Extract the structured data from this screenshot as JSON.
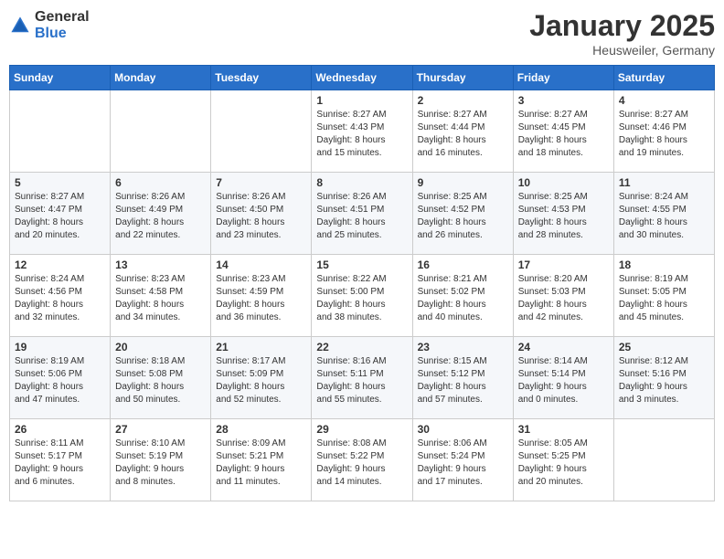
{
  "header": {
    "logo_general": "General",
    "logo_blue": "Blue",
    "month": "January 2025",
    "location": "Heusweiler, Germany"
  },
  "weekdays": [
    "Sunday",
    "Monday",
    "Tuesday",
    "Wednesday",
    "Thursday",
    "Friday",
    "Saturday"
  ],
  "weeks": [
    [
      {
        "day": "",
        "info": ""
      },
      {
        "day": "",
        "info": ""
      },
      {
        "day": "",
        "info": ""
      },
      {
        "day": "1",
        "info": "Sunrise: 8:27 AM\nSunset: 4:43 PM\nDaylight: 8 hours\nand 15 minutes."
      },
      {
        "day": "2",
        "info": "Sunrise: 8:27 AM\nSunset: 4:44 PM\nDaylight: 8 hours\nand 16 minutes."
      },
      {
        "day": "3",
        "info": "Sunrise: 8:27 AM\nSunset: 4:45 PM\nDaylight: 8 hours\nand 18 minutes."
      },
      {
        "day": "4",
        "info": "Sunrise: 8:27 AM\nSunset: 4:46 PM\nDaylight: 8 hours\nand 19 minutes."
      }
    ],
    [
      {
        "day": "5",
        "info": "Sunrise: 8:27 AM\nSunset: 4:47 PM\nDaylight: 8 hours\nand 20 minutes."
      },
      {
        "day": "6",
        "info": "Sunrise: 8:26 AM\nSunset: 4:49 PM\nDaylight: 8 hours\nand 22 minutes."
      },
      {
        "day": "7",
        "info": "Sunrise: 8:26 AM\nSunset: 4:50 PM\nDaylight: 8 hours\nand 23 minutes."
      },
      {
        "day": "8",
        "info": "Sunrise: 8:26 AM\nSunset: 4:51 PM\nDaylight: 8 hours\nand 25 minutes."
      },
      {
        "day": "9",
        "info": "Sunrise: 8:25 AM\nSunset: 4:52 PM\nDaylight: 8 hours\nand 26 minutes."
      },
      {
        "day": "10",
        "info": "Sunrise: 8:25 AM\nSunset: 4:53 PM\nDaylight: 8 hours\nand 28 minutes."
      },
      {
        "day": "11",
        "info": "Sunrise: 8:24 AM\nSunset: 4:55 PM\nDaylight: 8 hours\nand 30 minutes."
      }
    ],
    [
      {
        "day": "12",
        "info": "Sunrise: 8:24 AM\nSunset: 4:56 PM\nDaylight: 8 hours\nand 32 minutes."
      },
      {
        "day": "13",
        "info": "Sunrise: 8:23 AM\nSunset: 4:58 PM\nDaylight: 8 hours\nand 34 minutes."
      },
      {
        "day": "14",
        "info": "Sunrise: 8:23 AM\nSunset: 4:59 PM\nDaylight: 8 hours\nand 36 minutes."
      },
      {
        "day": "15",
        "info": "Sunrise: 8:22 AM\nSunset: 5:00 PM\nDaylight: 8 hours\nand 38 minutes."
      },
      {
        "day": "16",
        "info": "Sunrise: 8:21 AM\nSunset: 5:02 PM\nDaylight: 8 hours\nand 40 minutes."
      },
      {
        "day": "17",
        "info": "Sunrise: 8:20 AM\nSunset: 5:03 PM\nDaylight: 8 hours\nand 42 minutes."
      },
      {
        "day": "18",
        "info": "Sunrise: 8:19 AM\nSunset: 5:05 PM\nDaylight: 8 hours\nand 45 minutes."
      }
    ],
    [
      {
        "day": "19",
        "info": "Sunrise: 8:19 AM\nSunset: 5:06 PM\nDaylight: 8 hours\nand 47 minutes."
      },
      {
        "day": "20",
        "info": "Sunrise: 8:18 AM\nSunset: 5:08 PM\nDaylight: 8 hours\nand 50 minutes."
      },
      {
        "day": "21",
        "info": "Sunrise: 8:17 AM\nSunset: 5:09 PM\nDaylight: 8 hours\nand 52 minutes."
      },
      {
        "day": "22",
        "info": "Sunrise: 8:16 AM\nSunset: 5:11 PM\nDaylight: 8 hours\nand 55 minutes."
      },
      {
        "day": "23",
        "info": "Sunrise: 8:15 AM\nSunset: 5:12 PM\nDaylight: 8 hours\nand 57 minutes."
      },
      {
        "day": "24",
        "info": "Sunrise: 8:14 AM\nSunset: 5:14 PM\nDaylight: 9 hours\nand 0 minutes."
      },
      {
        "day": "25",
        "info": "Sunrise: 8:12 AM\nSunset: 5:16 PM\nDaylight: 9 hours\nand 3 minutes."
      }
    ],
    [
      {
        "day": "26",
        "info": "Sunrise: 8:11 AM\nSunset: 5:17 PM\nDaylight: 9 hours\nand 6 minutes."
      },
      {
        "day": "27",
        "info": "Sunrise: 8:10 AM\nSunset: 5:19 PM\nDaylight: 9 hours\nand 8 minutes."
      },
      {
        "day": "28",
        "info": "Sunrise: 8:09 AM\nSunset: 5:21 PM\nDaylight: 9 hours\nand 11 minutes."
      },
      {
        "day": "29",
        "info": "Sunrise: 8:08 AM\nSunset: 5:22 PM\nDaylight: 9 hours\nand 14 minutes."
      },
      {
        "day": "30",
        "info": "Sunrise: 8:06 AM\nSunset: 5:24 PM\nDaylight: 9 hours\nand 17 minutes."
      },
      {
        "day": "31",
        "info": "Sunrise: 8:05 AM\nSunset: 5:25 PM\nDaylight: 9 hours\nand 20 minutes."
      },
      {
        "day": "",
        "info": ""
      }
    ]
  ]
}
